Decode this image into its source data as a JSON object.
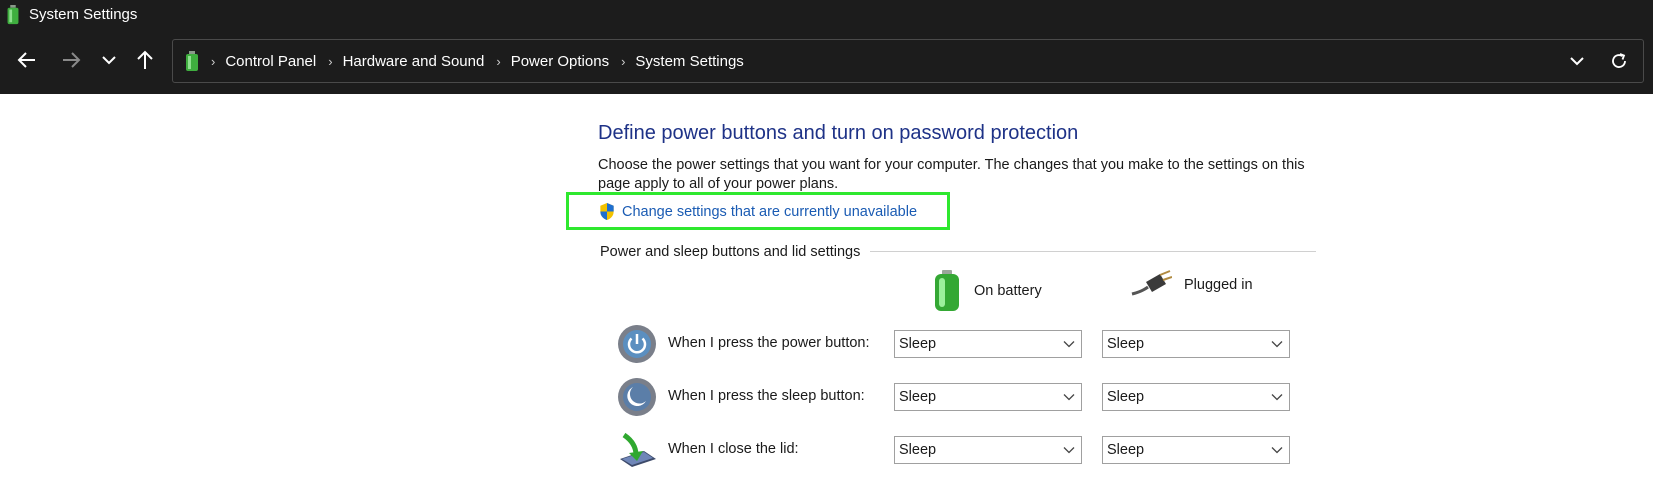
{
  "window": {
    "title": "System Settings"
  },
  "nav": {
    "breadcrumbs": [
      "Control Panel",
      "Hardware and Sound",
      "Power Options",
      "System Settings"
    ]
  },
  "content": {
    "title": "Define power buttons and turn on password protection",
    "description": "Choose the power settings that you want for your computer. The changes that you make to the settings on this page apply to all of your power plans.",
    "change_link": "Change settings that are currently unavailable",
    "group_label": "Power and sleep buttons and lid settings",
    "columns": {
      "battery": "On battery",
      "plugged": "Plugged in"
    },
    "rows": [
      {
        "label": "When I press the power button:",
        "battery": "Sleep",
        "plugged": "Sleep"
      },
      {
        "label": "When I press the sleep button:",
        "battery": "Sleep",
        "plugged": "Sleep"
      },
      {
        "label": "When I close the lid:",
        "battery": "Sleep",
        "plugged": "Sleep"
      }
    ]
  },
  "colors": {
    "title_blue": "#1e3287",
    "link_blue": "#1a5bb3",
    "highlight_green": "#2ee82e",
    "chrome_dark": "#1c1c1c"
  },
  "icons": [
    "battery-icon",
    "back-arrow-icon",
    "forward-arrow-icon",
    "chevron-down-icon",
    "up-arrow-icon",
    "refresh-icon",
    "uac-shield-icon",
    "power-button-icon",
    "sleep-button-icon",
    "lid-icon",
    "plug-icon"
  ]
}
